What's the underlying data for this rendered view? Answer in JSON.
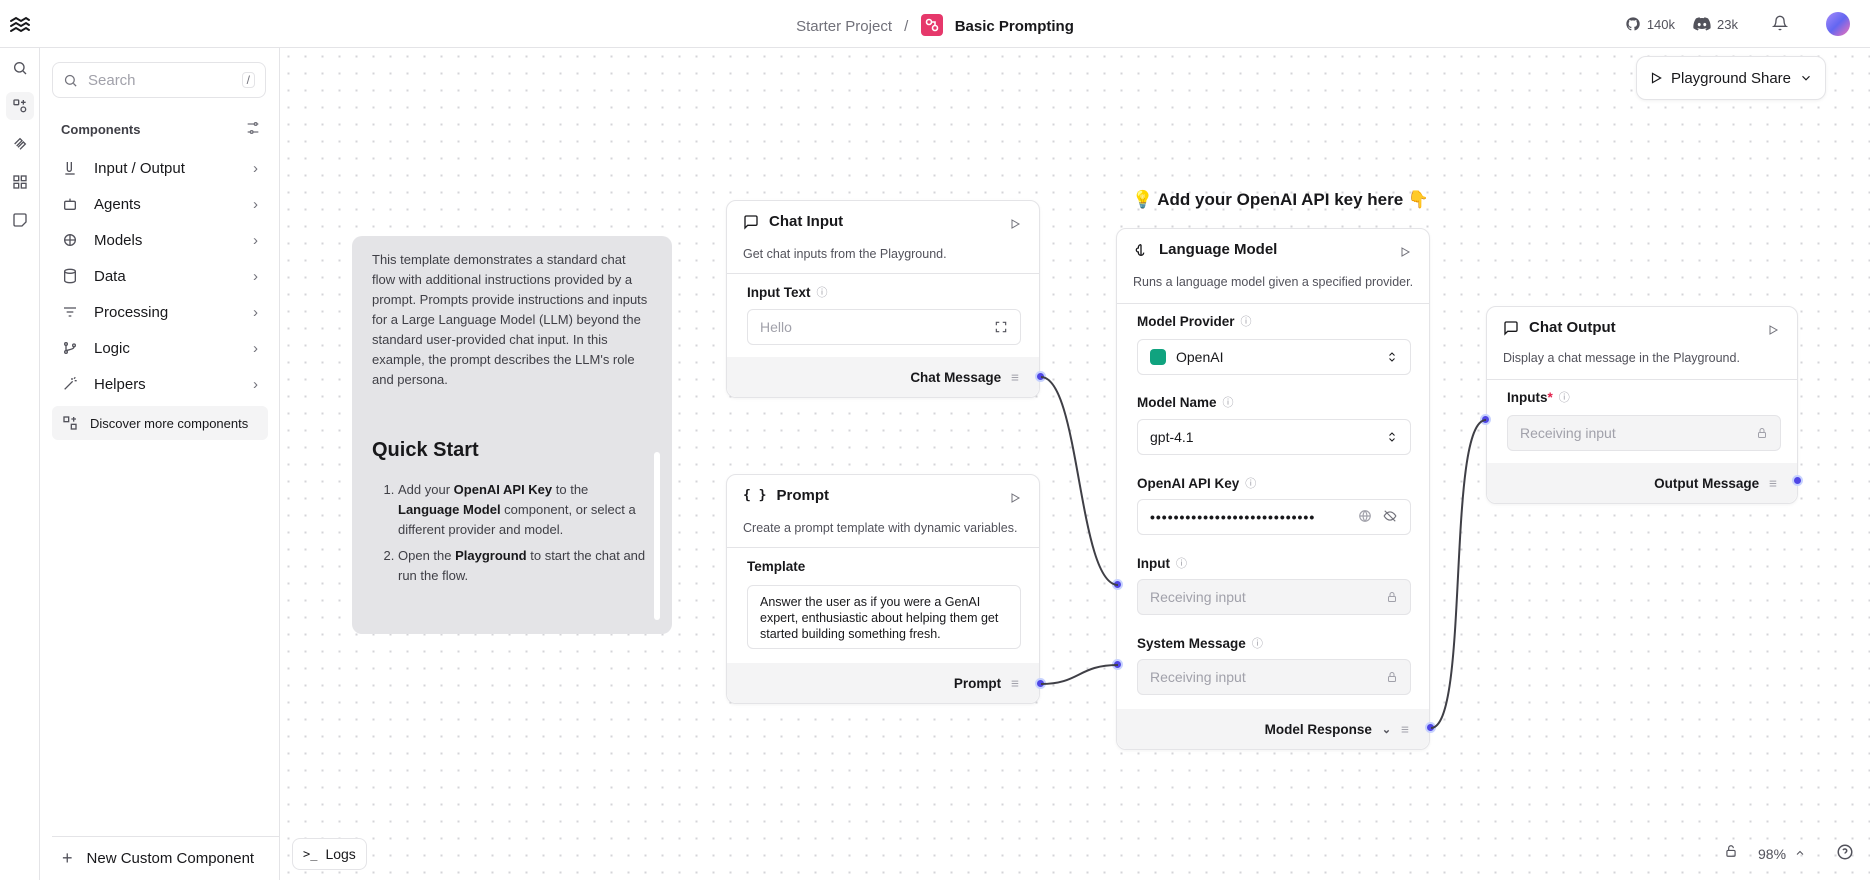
{
  "breadcrumb": {
    "project": "Starter Project",
    "separator": "/",
    "flow": "Basic Prompting"
  },
  "header": {
    "github_count": "140k",
    "discord_count": "23k"
  },
  "sidebar": {
    "search_placeholder": "Search",
    "search_shortcut": "/",
    "components_title": "Components",
    "categories": [
      {
        "label": "Input / Output",
        "icon": "input-output-icon"
      },
      {
        "label": "Agents",
        "icon": "bot-icon"
      },
      {
        "label": "Models",
        "icon": "brain-icon"
      },
      {
        "label": "Data",
        "icon": "database-icon"
      },
      {
        "label": "Processing",
        "icon": "list-filter-icon"
      },
      {
        "label": "Logic",
        "icon": "git-branch-icon"
      },
      {
        "label": "Helpers",
        "icon": "wand-icon"
      }
    ],
    "discover": "Discover more components",
    "new_component": "New Custom Component"
  },
  "toolbar": {
    "playground": "Playground",
    "share": "Share"
  },
  "note": {
    "intro": "This template demonstrates a standard chat flow with additional instructions provided by a prompt. Prompts provide instructions and inputs for a Large Language Model (LLM) beyond the standard user-provided chat input. In this example, the prompt describes the LLM's role and persona.",
    "quick_start": "Quick Start",
    "step1_a": "Add your ",
    "step1_b": "OpenAI API Key",
    "step1_c": " to the ",
    "step1_d": "Language Model",
    "step1_e": " component, or select a different provider and model.",
    "step2_a": "Open the ",
    "step2_b": "Playground",
    "step2_c": " to start the chat and run the flow."
  },
  "chat_input": {
    "title": "Chat Input",
    "description": "Get chat inputs from the Playground.",
    "field_label": "Input Text",
    "field_placeholder": "Hello",
    "output": "Chat Message"
  },
  "prompt": {
    "title": "Prompt",
    "description": "Create a prompt template with dynamic variables.",
    "field_label": "Template",
    "template": "Answer the user as if you were a GenAI expert, enthusiastic about helping them get started building something fresh.",
    "output": "Prompt"
  },
  "api_note": "💡 Add your OpenAI API key here 👇",
  "language_model": {
    "title": "Language Model",
    "description": "Runs a language model given a specified provider.",
    "provider_label": "Model Provider",
    "provider_value": "OpenAI",
    "model_label": "Model Name",
    "model_value": "gpt-4.1",
    "api_key_label": "OpenAI API Key",
    "api_key_value": "••••••••••••••••••••••••••••",
    "input_label": "Input",
    "input_placeholder": "Receiving input",
    "system_label": "System Message",
    "system_placeholder": "Receiving input",
    "output": "Model Response"
  },
  "chat_output": {
    "title": "Chat Output",
    "description": "Display a chat message in the Playground.",
    "inputs_label": "Inputs",
    "required_mark": "*",
    "inputs_placeholder": "Receiving input",
    "output": "Output Message"
  },
  "bottom": {
    "logs": "Logs",
    "zoom": "98%"
  },
  "colors": {
    "accent": "#4f46e5",
    "flow_icon": "#e6386b",
    "openai_green": "#10a37f"
  }
}
